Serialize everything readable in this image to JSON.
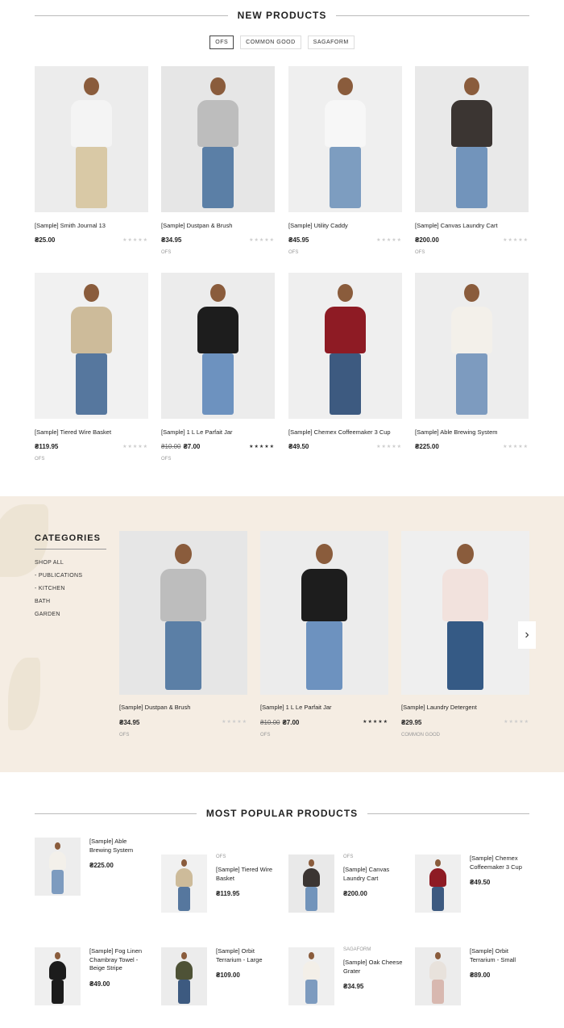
{
  "new_products": {
    "title": "NEW PRODUCTS",
    "tabs": [
      "OFS",
      "COMMON GOOD",
      "SAGAFORM"
    ],
    "items": [
      {
        "name": "[Sample] Smith Journal 13",
        "price": "₴25.00",
        "old_price": "",
        "stars": "★★★★★",
        "rated": false,
        "brand": ""
      },
      {
        "name": "[Sample] Dustpan & Brush",
        "price": "₴34.95",
        "old_price": "",
        "stars": "★★★★★",
        "rated": false,
        "brand": "OFS"
      },
      {
        "name": "[Sample] Utility Caddy",
        "price": "₴45.95",
        "old_price": "",
        "stars": "★★★★★",
        "rated": false,
        "brand": "OFS"
      },
      {
        "name": "[Sample] Canvas Laundry Cart",
        "price": "₴200.00",
        "old_price": "",
        "stars": "★★★★★",
        "rated": false,
        "brand": "OFS"
      },
      {
        "name": "[Sample] Tiered Wire Basket",
        "price": "₴119.95",
        "old_price": "",
        "stars": "★★★★★",
        "rated": false,
        "brand": "OFS"
      },
      {
        "name": "[Sample] 1 L Le Parfait Jar",
        "price": "₴7.00",
        "old_price": "₴10.00",
        "stars": "★★★★★",
        "rated": true,
        "brand": "OFS"
      },
      {
        "name": "[Sample] Chemex Coffeemaker 3 Cup",
        "price": "₴49.50",
        "old_price": "",
        "stars": "★★★★★",
        "rated": false,
        "brand": ""
      },
      {
        "name": "[Sample] Able Brewing System",
        "price": "₴225.00",
        "old_price": "",
        "stars": "★★★★★",
        "rated": false,
        "brand": ""
      }
    ]
  },
  "categories": {
    "title": "CATEGORIES",
    "items": [
      "SHOP ALL",
      "- PUBLICATIONS",
      "- KITCHEN",
      "BATH",
      "GARDEN"
    ],
    "products": [
      {
        "name": "[Sample] Dustpan & Brush",
        "price": "₴34.95",
        "old_price": "",
        "stars": "★★★★★",
        "rated": false,
        "brand": "OFS"
      },
      {
        "name": "[Sample] 1 L Le Parfait Jar",
        "price": "₴7.00",
        "old_price": "₴10.00",
        "stars": "★★★★★",
        "rated": true,
        "brand": "OFS"
      },
      {
        "name": "[Sample] Laundry Detergent",
        "price": "₴29.95",
        "old_price": "",
        "stars": "★★★★★",
        "rated": false,
        "brand": "COMMON GOOD"
      }
    ],
    "next_arrow": "›"
  },
  "popular": {
    "title": "MOST POPULAR PRODUCTS",
    "items": [
      {
        "brand": "",
        "name": "[Sample] Able Brewing System",
        "price": "₴225.00"
      },
      {
        "brand": "OFS",
        "name": "[Sample] Tiered Wire Basket",
        "price": "₴119.95"
      },
      {
        "brand": "OFS",
        "name": "[Sample] Canvas Laundry Cart",
        "price": "₴200.00"
      },
      {
        "brand": "",
        "name": "[Sample] Chemex Coffeemaker 3 Cup",
        "price": "₴49.50"
      },
      {
        "brand": "",
        "name": "[Sample] Fog Linen Chambray Towel - Beige Stripe",
        "price": "₴49.00"
      },
      {
        "brand": "",
        "name": "[Sample] Orbit Terrarium - Large",
        "price": "₴109.00"
      },
      {
        "brand": "Sagaform",
        "name": "[Sample] Oak Cheese Grater",
        "price": "₴34.95"
      },
      {
        "brand": "",
        "name": "[Sample] Orbit Terrarium - Small",
        "price": "₴89.00"
      }
    ]
  }
}
